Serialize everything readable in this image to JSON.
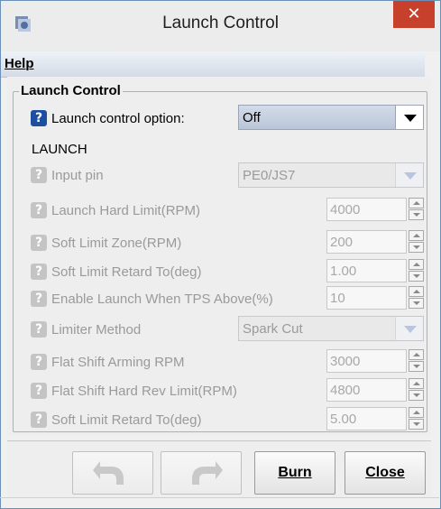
{
  "window": {
    "title": "Launch Control",
    "close_glyph": "✕"
  },
  "menu": {
    "help_label": "Help"
  },
  "group": {
    "title": "Launch Control"
  },
  "launch_option": {
    "help_glyph": "?",
    "label": "Launch control option:",
    "value": "Off"
  },
  "section_label": "LAUNCH",
  "fields": [
    {
      "label": "Input pin",
      "kind": "combo",
      "value": "PE0/JS7"
    },
    {
      "label": "Launch Hard Limit(RPM)",
      "kind": "spinner",
      "value": "4000"
    },
    {
      "label": "Soft Limit Zone(RPM)",
      "kind": "spinner",
      "value": "200"
    },
    {
      "label": "Soft Limit Retard To(deg)",
      "kind": "spinner",
      "value": "1.00"
    },
    {
      "label": "Enable Launch When TPS Above(%)",
      "kind": "spinner",
      "value": "10"
    },
    {
      "label": "Limiter Method",
      "kind": "combo",
      "value": "Spark Cut"
    },
    {
      "label": "Flat Shift Arming RPM",
      "kind": "spinner",
      "value": "3000"
    },
    {
      "label": "Flat Shift Hard Rev Limit(RPM)",
      "kind": "spinner",
      "value": "4800"
    },
    {
      "label": "Soft Limit Retard To(deg)",
      "kind": "spinner",
      "value": "5.00"
    }
  ],
  "buttons": {
    "undo_icon": "undo-arrow-icon",
    "redo_icon": "redo-arrow-icon",
    "burn_label": "Burn",
    "close_label": "Close"
  },
  "colors": {
    "accent": "#1c4f9e",
    "close": "#c7402b",
    "combo_active": "#bac6d8"
  }
}
